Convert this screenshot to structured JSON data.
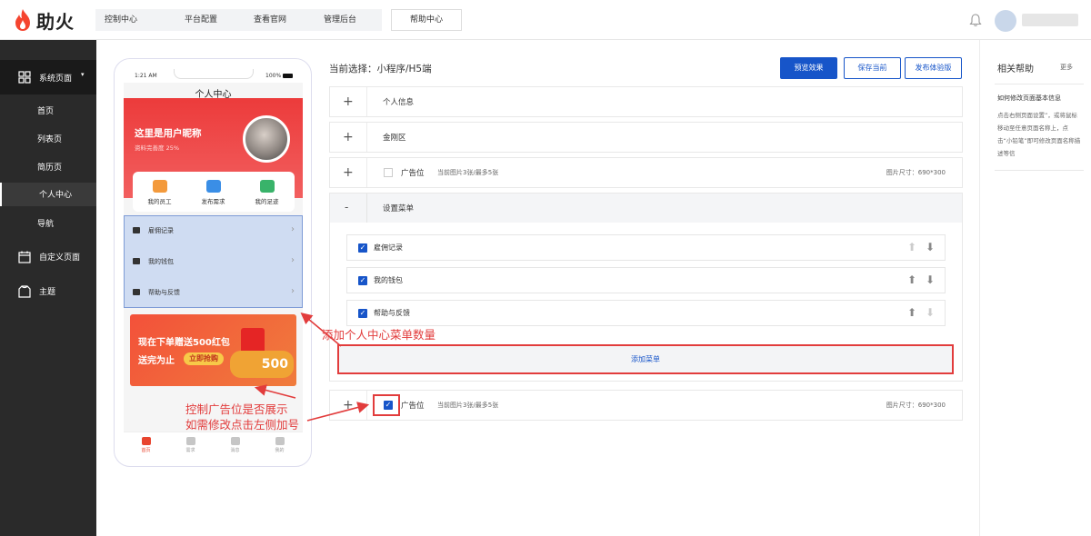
{
  "brand": {
    "name": "助火",
    "color": "#f5442f"
  },
  "topnav": {
    "items": [
      "控制中心",
      "平台配置",
      "查看官网",
      "管理后台"
    ],
    "help": "帮助中心"
  },
  "sidebar": {
    "group": "系统页面",
    "items": [
      "首页",
      "列表页",
      "简历页",
      "个人中心",
      "导航"
    ],
    "active": "个人中心",
    "others": [
      "自定义页面",
      "主题"
    ]
  },
  "phone": {
    "time": "1:21 AM",
    "battery": "100%",
    "page_title": "个人中心",
    "user_name": "这里是用户昵称",
    "completeness": "资料完善度 25%",
    "quick": [
      "我的员工",
      "发布需求",
      "我的足迹"
    ],
    "menu": [
      "雇佣记录",
      "我的钱包",
      "帮助与反馈"
    ],
    "promo_line1": "现在下单赠送500红包",
    "promo_line2": "送完为止",
    "promo_btn": "立即抢购",
    "promo_num": "500",
    "tabs": [
      "首页",
      "需求",
      "消息",
      "我的"
    ]
  },
  "main": {
    "current": "当前选择：小程序/H5端",
    "buttons": {
      "preview": "预览效果",
      "save": "保存当前",
      "publish": "发布体验版"
    },
    "panels": {
      "personal": "个人信息",
      "kingkong": "金刚区",
      "ad": "广告位",
      "ad_info": "当前图片3张/最多5张",
      "ad_size": "图片尺寸：690*300",
      "settings": "设置菜单",
      "add_menu": "添加菜单"
    },
    "menu_rows": [
      "雇佣记录",
      "我的钱包",
      "帮助与反馈"
    ],
    "accent": "#1755c9"
  },
  "annotations": {
    "a1": "添加个人中心菜单数量",
    "a2_line1": "控制广告位是否展示",
    "a2_line2": "如需修改点击左侧加号",
    "color": "#e23c3c"
  },
  "help": {
    "title": "相关帮助",
    "more": "更多",
    "question": "如何修改页面基本信息",
    "answer": "点击右侧页面设置”，或将鼠标移动至任意页面名称上，点击“小铅笔”即可修改页面名称描述等信"
  }
}
